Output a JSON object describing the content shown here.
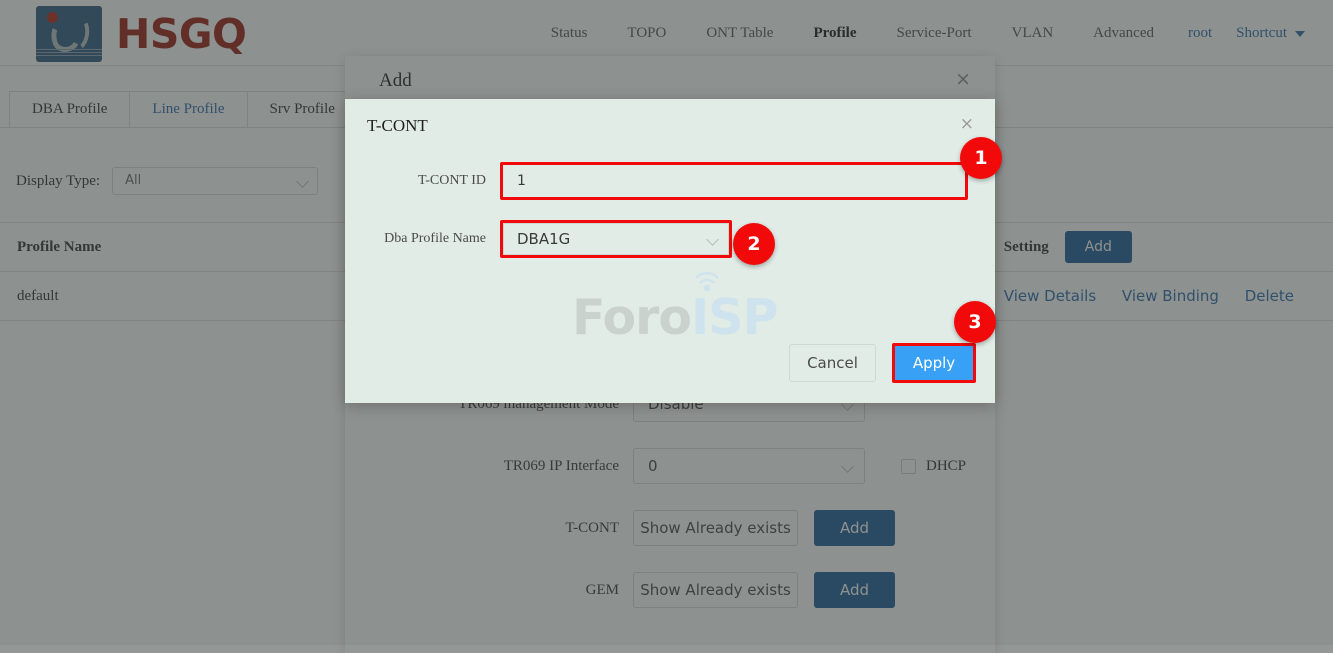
{
  "header": {
    "brand": "HSGQ",
    "nav_items": [
      {
        "label": "Status",
        "active": false
      },
      {
        "label": "TOPO",
        "active": false
      },
      {
        "label": "ONT Table",
        "active": false
      },
      {
        "label": "Profile",
        "active": true
      },
      {
        "label": "Service-Port",
        "active": false
      },
      {
        "label": "VLAN",
        "active": false
      },
      {
        "label": "Advanced",
        "active": false
      }
    ],
    "user": "root",
    "shortcut": "Shortcut"
  },
  "tabs": [
    {
      "label": "DBA Profile",
      "active": false
    },
    {
      "label": "Line Profile",
      "active": true
    },
    {
      "label": "Srv Profile",
      "active": false
    }
  ],
  "filter": {
    "label": "Display Type:",
    "value": "All"
  },
  "table": {
    "columns": [
      "Profile Name",
      "Setting"
    ],
    "setting_add_label": "Add",
    "rows": [
      {
        "profile_name": "default",
        "actions": [
          "View Details",
          "View Binding",
          "Delete"
        ]
      }
    ]
  },
  "add_modal": {
    "title": "Add",
    "close": "×",
    "fields": [
      {
        "label": "TR069 management Mode",
        "value": "Disable",
        "type": "select"
      },
      {
        "label": "TR069 IP Interface",
        "value": "0",
        "type": "select",
        "checkbox_label": "DHCP"
      },
      {
        "label": "T-CONT",
        "value": "Show Already exists",
        "type": "button",
        "add_label": "Add"
      },
      {
        "label": "GEM",
        "value": "Show Already exists",
        "type": "button",
        "add_label": "Add"
      }
    ]
  },
  "tcont_modal": {
    "title": "T-CONT",
    "close": "×",
    "tcont_id_label": "T-CONT ID",
    "tcont_id_value": "1",
    "dba_profile_label": "Dba Profile Name",
    "dba_profile_value": "DBA1G",
    "cancel_label": "Cancel",
    "apply_label": "Apply"
  },
  "watermark": {
    "part1": "Foro",
    "part2": "ISP"
  },
  "badges": [
    {
      "number": "1"
    },
    {
      "number": "2"
    },
    {
      "number": "3"
    }
  ],
  "colors": {
    "brand_red": "#9e1f15",
    "link_blue": "#2f6bb0",
    "button_blue": "#1f5c99",
    "apply_blue": "#38a0f5",
    "highlight_red": "#f20a0a",
    "modal_bg": "#e2ece7"
  }
}
